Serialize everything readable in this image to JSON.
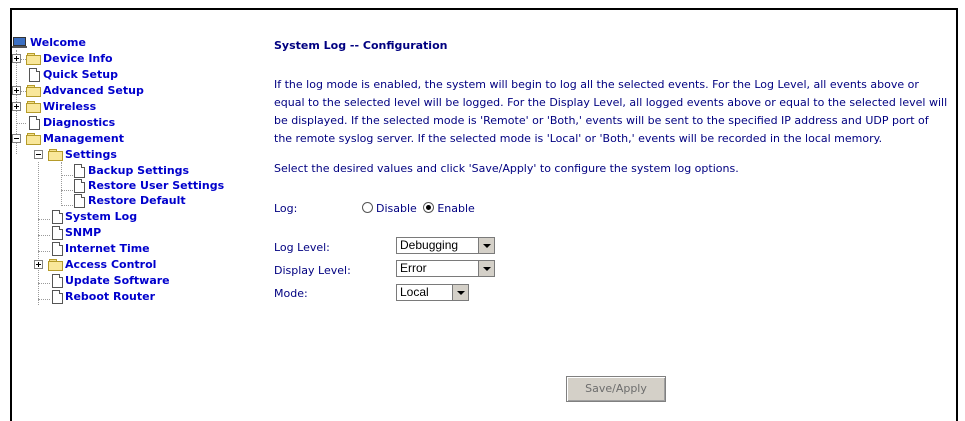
{
  "nav": {
    "welcome": "Welcome",
    "device_info": "Device Info",
    "quick_setup": "Quick Setup",
    "advanced_setup": "Advanced Setup",
    "wireless": "Wireless",
    "diagnostics": "Diagnostics",
    "management": "Management",
    "settings": "Settings",
    "backup_settings": "Backup Settings",
    "restore_user_settings": "Restore User Settings",
    "restore_default": "Restore Default",
    "system_log": "System Log",
    "snmp": "SNMP",
    "internet_time": "Internet Time",
    "access_control": "Access Control",
    "update_software": "Update Software",
    "reboot_router": "Reboot Router"
  },
  "page": {
    "title": "System Log -- Configuration",
    "description": "If the log mode is enabled, the system will begin to log all the selected events. For the Log Level, all events above or equal to the selected level will be logged. For the Display Level, all logged events above or equal to the selected level will be displayed. If the selected mode is 'Remote' or 'Both,' events will be sent to the specified IP address and UDP port of the remote syslog server. If the selected mode is 'Local' or 'Both,' events will be recorded in the local memory.",
    "instruction": "Select the desired values and click 'Save/Apply' to configure the system log options."
  },
  "form": {
    "log_label": "Log:",
    "disable_label": "Disable",
    "enable_label": "Enable",
    "log_level_label": "Log Level:",
    "log_level_value": "Debugging",
    "display_level_label": "Display Level:",
    "display_level_value": "Error",
    "mode_label": "Mode:",
    "mode_value": "Local",
    "save_button": "Save/Apply"
  }
}
